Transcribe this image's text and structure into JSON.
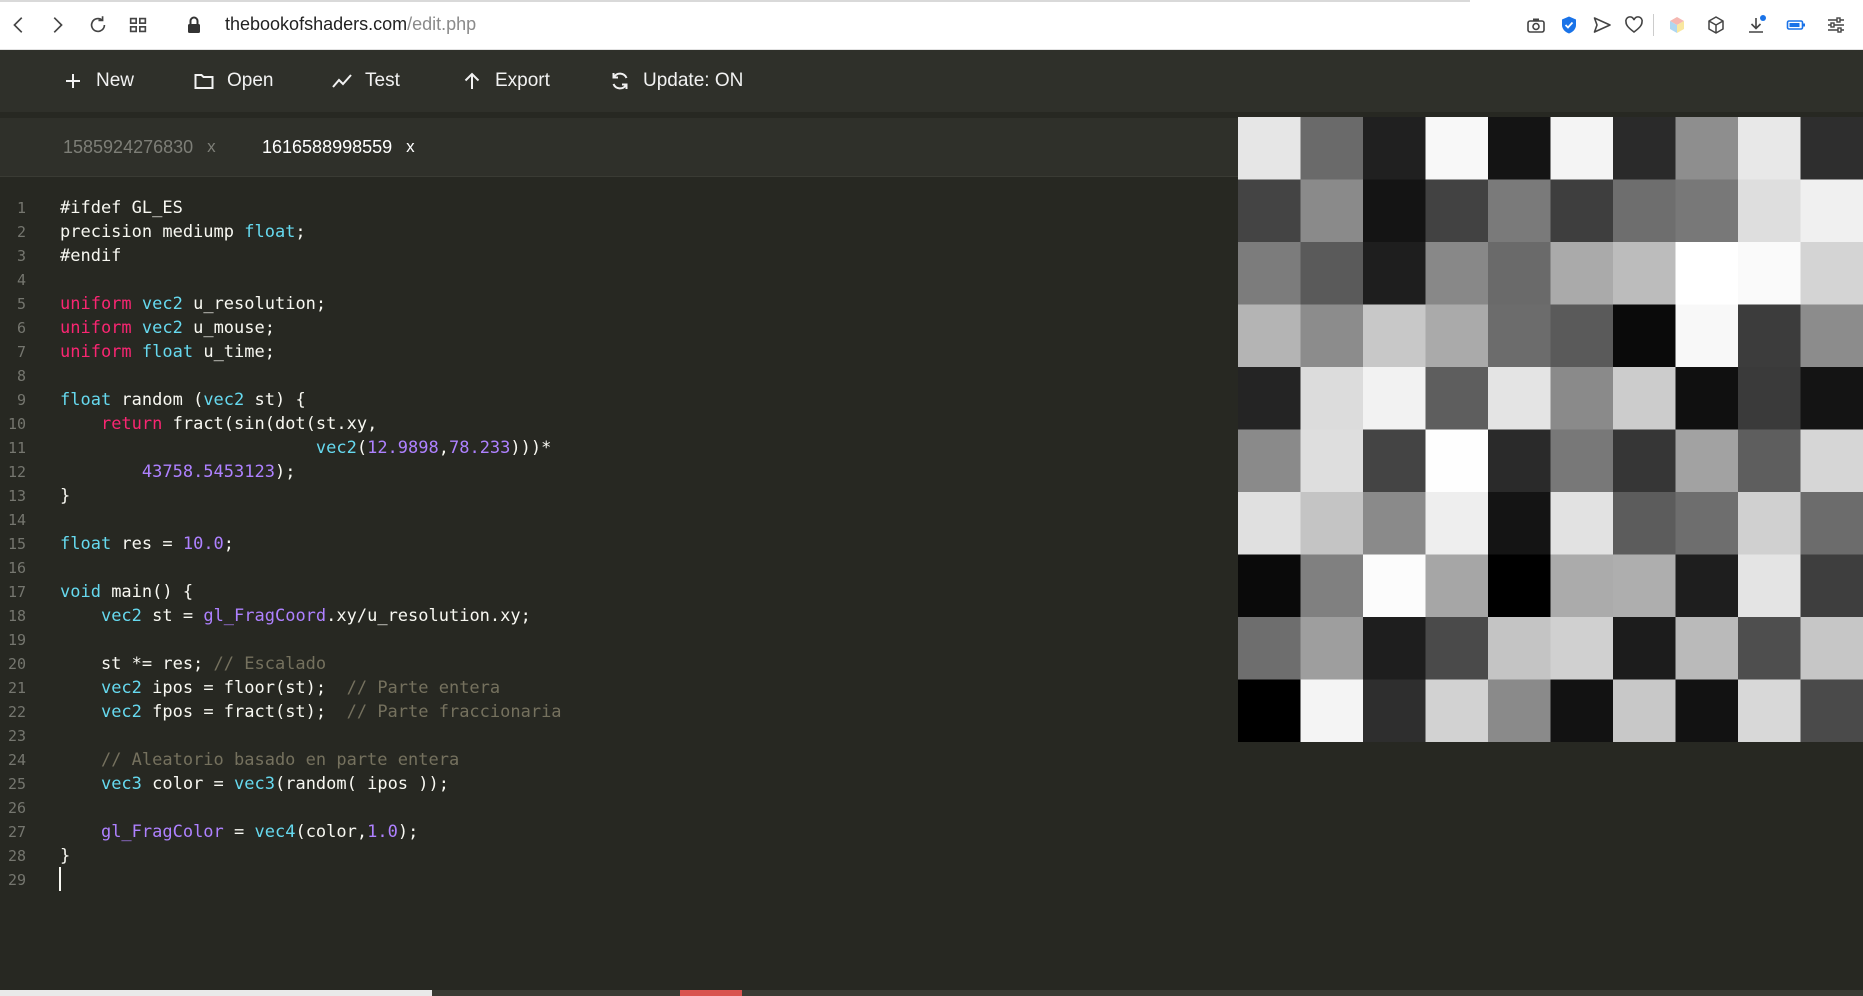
{
  "browser": {
    "url_domain": "thebookofshaders.com",
    "url_path": "/edit.php",
    "extension_icons": [
      "camera-icon",
      "shield-check-icon",
      "send-icon",
      "heart-icon",
      "cube-color-icon",
      "cube-icon",
      "download-icon",
      "battery-icon",
      "settings-sliders-icon"
    ],
    "accent_color": "#1a73e8"
  },
  "menu": {
    "new_label": "New",
    "open_label": "Open",
    "test_label": "Test",
    "export_label": "Export",
    "update_label": "Update: ON"
  },
  "tabs": [
    {
      "label": "1585924276830",
      "close": "x",
      "active": false
    },
    {
      "label": "1616588998559",
      "close": "x",
      "active": true
    }
  ],
  "code": {
    "line_numbers": [
      "1",
      "2",
      "3",
      "4",
      "5",
      "6",
      "7",
      "8",
      "9",
      "10",
      "11",
      "12",
      "13",
      "14",
      "15",
      "16",
      "17",
      "18",
      "19",
      "20",
      "21",
      "22",
      "23",
      "24",
      "25",
      "26",
      "27",
      "28",
      "29"
    ],
    "lines": [
      [
        [
          "p",
          "#ifdef GL_ES"
        ]
      ],
      [
        [
          "p",
          "precision mediump "
        ],
        [
          "t",
          "float"
        ],
        [
          "p",
          ";"
        ]
      ],
      [
        [
          "p",
          "#endif"
        ]
      ],
      [],
      [
        [
          "k",
          "uniform"
        ],
        [
          "p",
          " "
        ],
        [
          "t",
          "vec2"
        ],
        [
          "p",
          " u_resolution;"
        ]
      ],
      [
        [
          "k",
          "uniform"
        ],
        [
          "p",
          " "
        ],
        [
          "t",
          "vec2"
        ],
        [
          "p",
          " u_mouse;"
        ]
      ],
      [
        [
          "k",
          "uniform"
        ],
        [
          "p",
          " "
        ],
        [
          "t",
          "float"
        ],
        [
          "p",
          " u_time;"
        ]
      ],
      [],
      [
        [
          "t",
          "float"
        ],
        [
          "p",
          " random ("
        ],
        [
          "t",
          "vec2"
        ],
        [
          "p",
          " st) {"
        ]
      ],
      [
        [
          "p",
          "    "
        ],
        [
          "k",
          "return"
        ],
        [
          "p",
          " fract(sin(dot(st.xy,"
        ]
      ],
      [
        [
          "p",
          "                         "
        ],
        [
          "t",
          "vec2"
        ],
        [
          "p",
          "("
        ],
        [
          "n",
          "12.9898"
        ],
        [
          "p",
          ","
        ],
        [
          "n",
          "78.233"
        ],
        [
          "p",
          ")))*"
        ]
      ],
      [
        [
          "p",
          "        "
        ],
        [
          "n",
          "43758.5453123"
        ],
        [
          "p",
          ");"
        ]
      ],
      [
        [
          "p",
          "}"
        ]
      ],
      [],
      [
        [
          "t",
          "float"
        ],
        [
          "p",
          " res = "
        ],
        [
          "n",
          "10.0"
        ],
        [
          "p",
          ";"
        ]
      ],
      [],
      [
        [
          "t",
          "void"
        ],
        [
          "p",
          " main() {"
        ]
      ],
      [
        [
          "p",
          "    "
        ],
        [
          "t",
          "vec2"
        ],
        [
          "p",
          " st = "
        ],
        [
          "b",
          "gl_FragCoord"
        ],
        [
          "p",
          ".xy/u_resolution.xy;"
        ]
      ],
      [],
      [
        [
          "p",
          "    st *= res; "
        ],
        [
          "c",
          "// Escalado"
        ]
      ],
      [
        [
          "p",
          "    "
        ],
        [
          "t",
          "vec2"
        ],
        [
          "p",
          " ipos = floor(st);  "
        ],
        [
          "c",
          "// Parte entera"
        ]
      ],
      [
        [
          "p",
          "    "
        ],
        [
          "t",
          "vec2"
        ],
        [
          "p",
          " fpos = fract(st);  "
        ],
        [
          "c",
          "// Parte fraccionaria"
        ]
      ],
      [],
      [
        [
          "p",
          "    "
        ],
        [
          "c",
          "// Aleatorio basado en parte entera"
        ]
      ],
      [
        [
          "p",
          "    "
        ],
        [
          "t",
          "vec3"
        ],
        [
          "p",
          " color = "
        ],
        [
          "t",
          "vec3"
        ],
        [
          "p",
          "(random( ipos ));"
        ]
      ],
      [],
      [
        [
          "p",
          "    "
        ],
        [
          "b",
          "gl_FragColor"
        ],
        [
          "p",
          " = "
        ],
        [
          "t",
          "vec4"
        ],
        [
          "p",
          "(color,"
        ],
        [
          "n",
          "1.0"
        ],
        [
          "p",
          ");"
        ]
      ],
      [
        [
          "p",
          "}"
        ]
      ],
      []
    ]
  },
  "preview": {
    "grid_cols": 10,
    "grid_rows": 10,
    "cell_colors": [
      [
        "#e6e6e6",
        "#6a6a6a",
        "#202020",
        "#f8f8f8",
        "#141414",
        "#f4f4f4",
        "#2a2a2a",
        "#8e8e8e",
        "#e8e8e8",
        "#2e2e2e"
      ],
      [
        "#444444",
        "#8a8a8a",
        "#141414",
        "#424242",
        "#7a7a7a",
        "#3e3e3e",
        "#6e6e6e",
        "#787878",
        "#dedede",
        "#f0f0f0"
      ],
      [
        "#7c7c7c",
        "#5a5a5a",
        "#1e1e1e",
        "#888888",
        "#6a6a6a",
        "#aaaaaa",
        "#bcbcbc",
        "#ffffff",
        "#fafafa",
        "#d4d4d4"
      ],
      [
        "#b4b4b4",
        "#8c8c8c",
        "#c8c8c8",
        "#aaaaaa",
        "#6c6c6c",
        "#5a5a5a",
        "#0a0a0a",
        "#f8f8f8",
        "#3c3c3c",
        "#8c8c8c"
      ],
      [
        "#242424",
        "#dcdcdc",
        "#f2f2f2",
        "#5e5e5e",
        "#e4e4e4",
        "#8a8a8a",
        "#cccccc",
        "#101010",
        "#3a3a3a",
        "#141414"
      ],
      [
        "#8a8a8a",
        "#dedede",
        "#444444",
        "#fefefe",
        "#2a2a2a",
        "#787878",
        "#363636",
        "#a2a2a2",
        "#5e5e5e",
        "#d6d6d6"
      ],
      [
        "#e0e0e0",
        "#c4c4c4",
        "#8a8a8a",
        "#eeeeee",
        "#141414",
        "#e2e2e2",
        "#5c5c5c",
        "#6e6e6e",
        "#d0d0d0",
        "#6c6c6c"
      ],
      [
        "#0a0a0a",
        "#808080",
        "#fcfcfc",
        "#a6a6a6",
        "#000000",
        "#ababab",
        "#aeaeae",
        "#1e1e1e",
        "#e4e4e4",
        "#3e3e3e"
      ],
      [
        "#6e6e6e",
        "#9e9e9e",
        "#1e1e1e",
        "#4a4a4a",
        "#c4c4c4",
        "#d0d0d0",
        "#1c1c1c",
        "#bababa",
        "#4e4e4e",
        "#c6c6c6"
      ],
      [
        "#000000",
        "#f4f4f4",
        "#2e2e2e",
        "#d2d2d2",
        "#8a8a8a",
        "#121212",
        "#c8c8c8",
        "#121212",
        "#d8d8d8",
        "#4a4a4a"
      ]
    ]
  },
  "theme": {
    "background": "#272822",
    "menu_background": "#2f302a",
    "keyword_color": "#f92672",
    "type_color": "#66d9ef",
    "number_color": "#ae81ff",
    "comment_color": "#75715e"
  }
}
